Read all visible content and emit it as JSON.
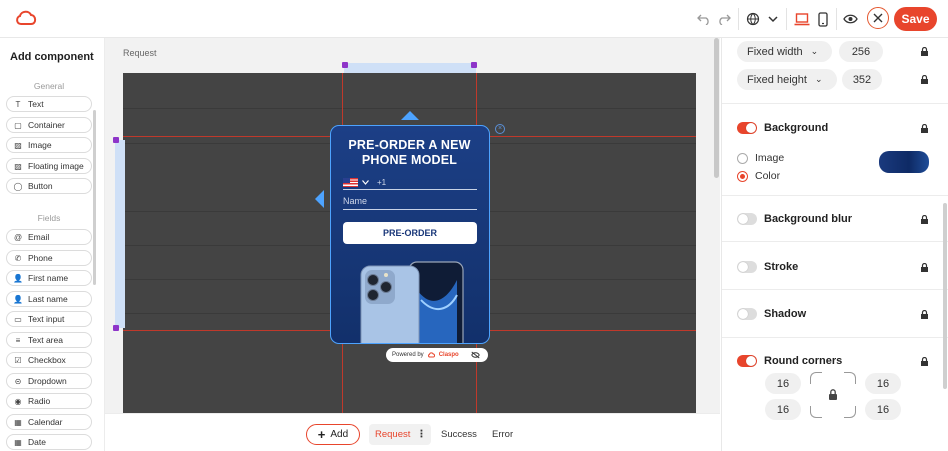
{
  "breadcrumb": "Request",
  "toolbar": {
    "save_label": "Save"
  },
  "left_panel": {
    "title": "Add component",
    "general_label": "General",
    "general": [
      {
        "label": "Text",
        "icon": "T"
      },
      {
        "label": "Container",
        "icon": "▢"
      },
      {
        "label": "Image",
        "icon": "▨"
      },
      {
        "label": "Floating image",
        "icon": "▨"
      },
      {
        "label": "Button",
        "icon": "◯"
      }
    ],
    "fields_label": "Fields",
    "fields": [
      {
        "label": "Email",
        "icon": "@"
      },
      {
        "label": "Phone",
        "icon": "✆"
      },
      {
        "label": "First name",
        "icon": "👤"
      },
      {
        "label": "Last name",
        "icon": "👤"
      },
      {
        "label": "Text input",
        "icon": "▭"
      },
      {
        "label": "Text area",
        "icon": "≡"
      },
      {
        "label": "Checkbox",
        "icon": "☑"
      },
      {
        "label": "Dropdown",
        "icon": "⊝"
      },
      {
        "label": "Radio",
        "icon": "◉"
      },
      {
        "label": "Calendar",
        "icon": "▦"
      },
      {
        "label": "Date",
        "icon": "▦"
      }
    ]
  },
  "popup": {
    "title_line1": "PRE-ORDER A NEW",
    "title_line2": "PHONE MODEL",
    "phone_code": "+1",
    "name_placeholder": "Name",
    "button_label": "PRE-ORDER",
    "powered_by": "Powered by",
    "brand": "Claspo"
  },
  "bottom": {
    "add_label": "Add",
    "tabs": [
      "Request",
      "Success",
      "Error"
    ]
  },
  "right_panel": {
    "width_mode": "Fixed width",
    "width_value": "256",
    "height_mode": "Fixed height",
    "height_value": "352",
    "background": {
      "title": "Background",
      "enabled": true,
      "option_image": "Image",
      "option_color": "Color",
      "selected": "Color"
    },
    "background_blur": {
      "title": "Background blur",
      "enabled": false
    },
    "stroke": {
      "title": "Stroke",
      "enabled": false
    },
    "shadow": {
      "title": "Shadow",
      "enabled": false
    },
    "round_corners": {
      "title": "Round corners",
      "enabled": true,
      "tl": "16",
      "tr": "16",
      "bl": "16",
      "br": "16"
    }
  },
  "colors": {
    "accent": "#e8452c",
    "popup_bg": "#1c3f86",
    "selection": "#4da3ff"
  }
}
